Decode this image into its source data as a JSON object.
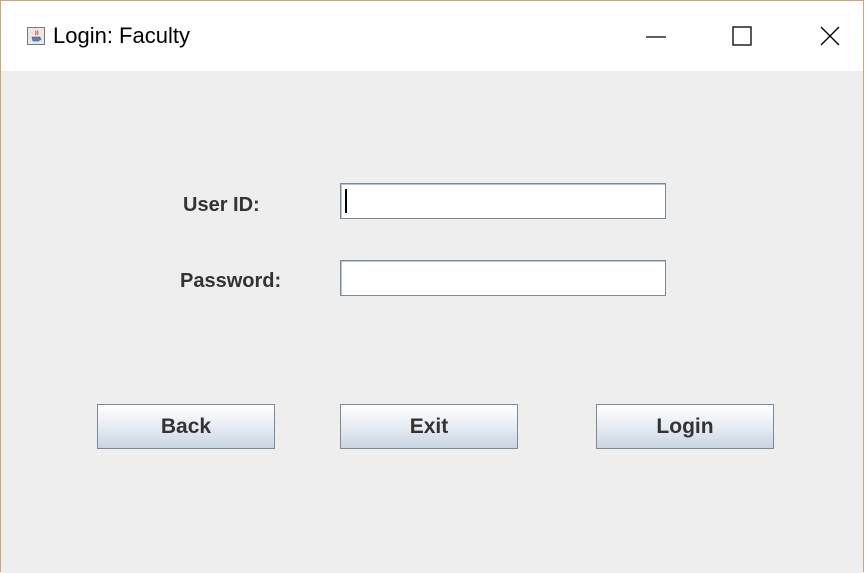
{
  "window": {
    "title": "Login: Faculty",
    "icon": "java-cup-icon",
    "controls": {
      "minimize": "minimize-icon",
      "maximize": "maximize-icon",
      "close": "close-icon"
    }
  },
  "form": {
    "user_id_label": "User ID:",
    "user_id_value": "",
    "password_label": "Password:",
    "password_value": ""
  },
  "buttons": {
    "back": "Back",
    "exit": "Exit",
    "login": "Login"
  },
  "colors": {
    "background": "#eeeeee",
    "titlebar": "#ffffff",
    "label_text": "#333333",
    "button_gradient_top": "#ffffff",
    "button_gradient_bottom": "#c9d6e4",
    "border": "#7a8a99"
  }
}
